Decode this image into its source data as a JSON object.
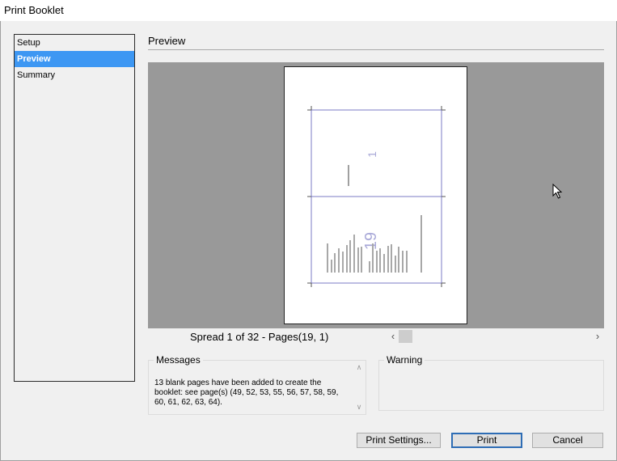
{
  "window": {
    "title": "Print Booklet"
  },
  "sidebar": {
    "items": [
      {
        "label": "Setup",
        "selected": false
      },
      {
        "label": "Preview",
        "selected": true
      },
      {
        "label": "Summary",
        "selected": false
      }
    ]
  },
  "main": {
    "section_title": "Preview",
    "preview": {
      "page_numbers": [
        "1",
        "19"
      ],
      "spread_label": "Spread 1 of 32 - Pages(19, 1)"
    },
    "messages": {
      "label": "Messages",
      "text": "13 blank pages have been added to create the booklet: see page(s) (49, 52, 53, 55, 56, 57, 58, 59, 60, 61, 62, 63, 64)."
    },
    "warning": {
      "label": "Warning"
    }
  },
  "buttons": {
    "print_settings": "Print Settings...",
    "print": "Print",
    "cancel": "Cancel"
  },
  "colors": {
    "selection": "#3d97f3",
    "preview_bg": "#999999",
    "guide": "#7b7bc4",
    "default_button_border": "#2e6db5"
  }
}
